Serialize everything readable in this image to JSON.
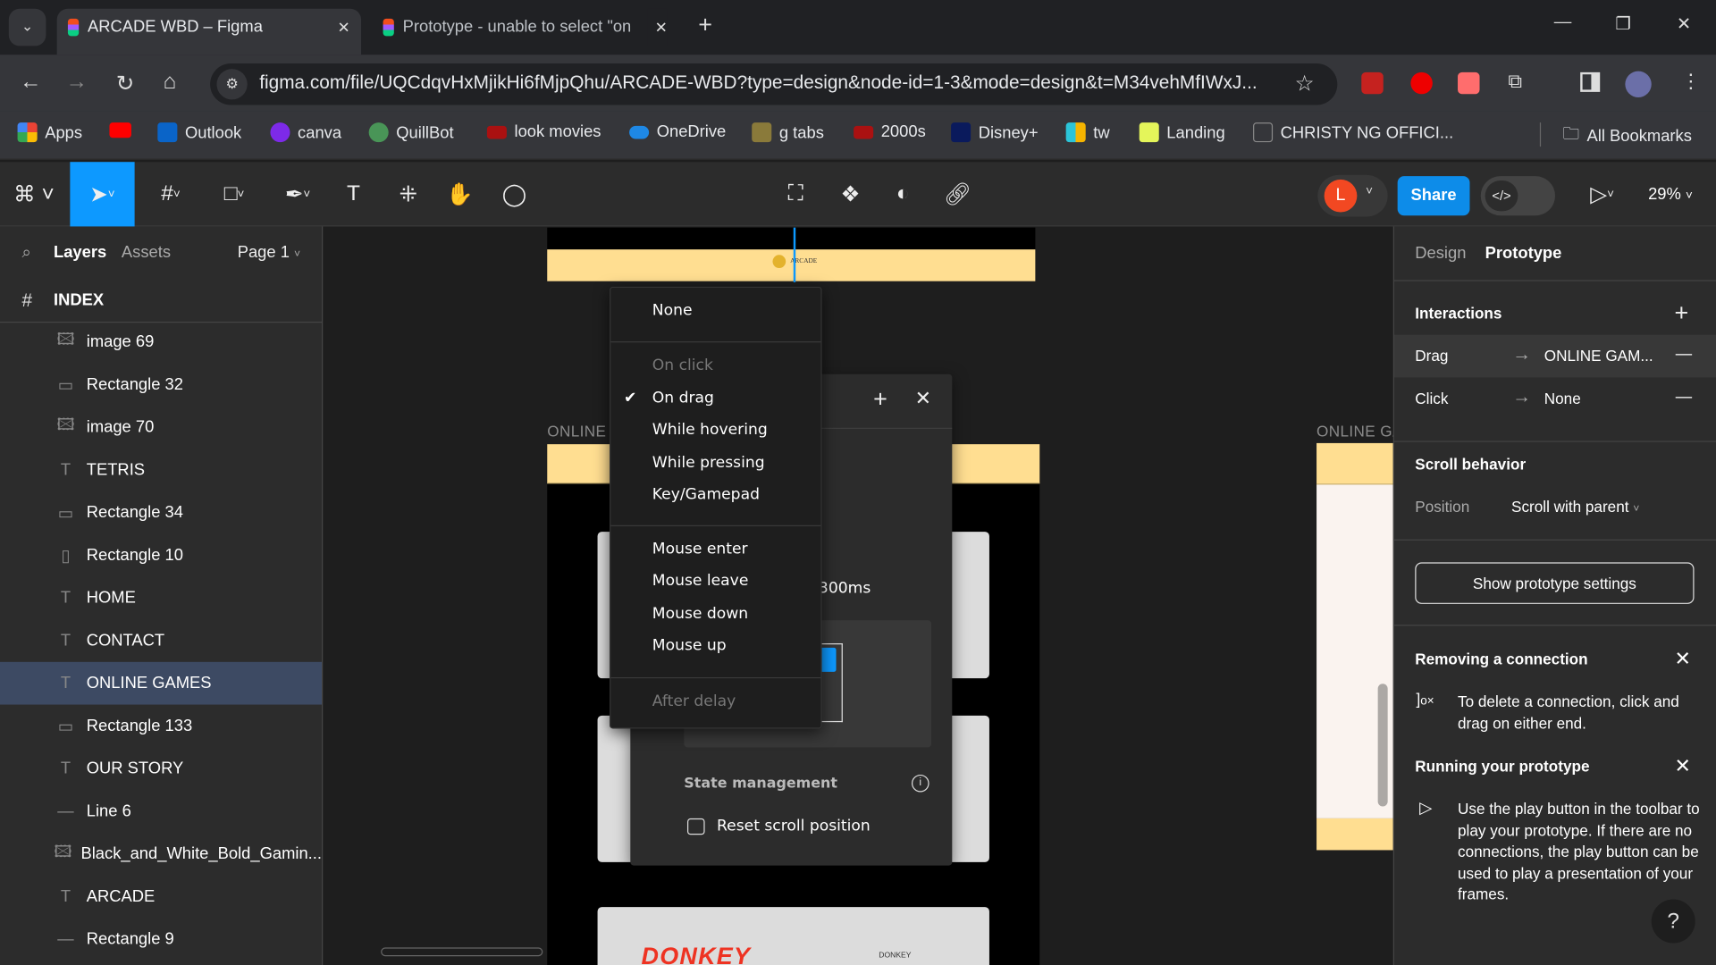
{
  "browser": {
    "tabs": [
      {
        "title": "ARCADE WBD – Figma",
        "active": true
      },
      {
        "title": "Prototype - unable to select \"on",
        "active": false
      }
    ],
    "url": "figma.com/file/UQCdqvHxMjikHi6fMjpQhu/ARCADE-WBD?type=design&node-id=1-3&mode=design&t=M34vehMfIWxJ...",
    "bookmarks": [
      "Apps",
      "",
      "Outlook",
      "canva",
      "QuillBot",
      "look movies",
      "OneDrive",
      "g tabs",
      "2000s",
      "Disney+",
      "tw",
      "Landing",
      "CHRISTY NG OFFICI..."
    ],
    "all_bookmarks": "All Bookmarks"
  },
  "toolbar": {
    "avatar_letter": "L",
    "share": "Share",
    "zoom": "29%",
    "accent": "#0d99ff"
  },
  "layers_panel": {
    "tab_layers": "Layers",
    "tab_assets": "Assets",
    "page": "Page 1",
    "frame": "INDEX",
    "items": [
      {
        "icon": "image-icon",
        "name": "image 69"
      },
      {
        "icon": "rectangle-icon",
        "name": "Rectangle 32"
      },
      {
        "icon": "image-icon",
        "name": "image 70"
      },
      {
        "icon": "text-icon",
        "name": "TETRIS"
      },
      {
        "icon": "rectangle-icon",
        "name": "Rectangle 34"
      },
      {
        "icon": "rectangle-vertical-icon",
        "name": "Rectangle 10"
      },
      {
        "icon": "text-icon",
        "name": "HOME"
      },
      {
        "icon": "text-icon",
        "name": "CONTACT"
      },
      {
        "icon": "text-icon",
        "name": "ONLINE GAMES",
        "selected": true
      },
      {
        "icon": "rectangle-icon",
        "name": "Rectangle 133"
      },
      {
        "icon": "text-icon",
        "name": "OUR STORY"
      },
      {
        "icon": "line-icon",
        "name": "Line 6"
      },
      {
        "icon": "image-icon",
        "name": "Black_and_White_Bold_Gamin..."
      },
      {
        "icon": "text-icon",
        "name": "ARCADE"
      },
      {
        "icon": "line-icon",
        "name": "Rectangle 9"
      }
    ]
  },
  "canvas": {
    "frame_label_left": "ONLINE G",
    "frame_label_right": "ONLINE GA",
    "header_logo_text": "ARCADE",
    "card_text": "DONKEY",
    "card_logo": "DONKEY"
  },
  "trigger_menu": {
    "items": [
      {
        "label": "None",
        "group": 0
      },
      {
        "label": "On click",
        "disabled": true,
        "group": 1
      },
      {
        "label": "On drag",
        "checked": true,
        "group": 1
      },
      {
        "label": "While hovering",
        "group": 1
      },
      {
        "label": "While pressing",
        "group": 1
      },
      {
        "label": "Key/Gamepad",
        "group": 1
      },
      {
        "label": "Mouse enter",
        "group": 2
      },
      {
        "label": "Mouse leave",
        "group": 2
      },
      {
        "label": "Mouse down",
        "group": 2
      },
      {
        "label": "Mouse up",
        "group": 2
      },
      {
        "label": "After delay",
        "disabled": true,
        "group": 3
      }
    ]
  },
  "interaction_panel": {
    "duration": "300ms",
    "state_management": "State management",
    "reset_scroll": "Reset scroll position",
    "reset_scroll_checked": false
  },
  "right_panel": {
    "tab_design": "Design",
    "tab_prototype": "Prototype",
    "interactions_title": "Interactions",
    "interactions": [
      {
        "trigger": "Drag",
        "target": "ONLINE GAM..."
      },
      {
        "trigger": "Click",
        "target": "None"
      }
    ],
    "scroll_title": "Scroll behavior",
    "position_label": "Position",
    "position_value": "Scroll with parent",
    "settings_button": "Show prototype settings",
    "tip1_title": "Removing a connection",
    "tip1_text": "To delete a connection, click and drag on either end.",
    "tip2_title": "Running your prototype",
    "tip2_text": "Use the play button in the toolbar to play your prototype. If there are no connections, the play button can be used to play a presentation of your frames.",
    "help": "?"
  }
}
